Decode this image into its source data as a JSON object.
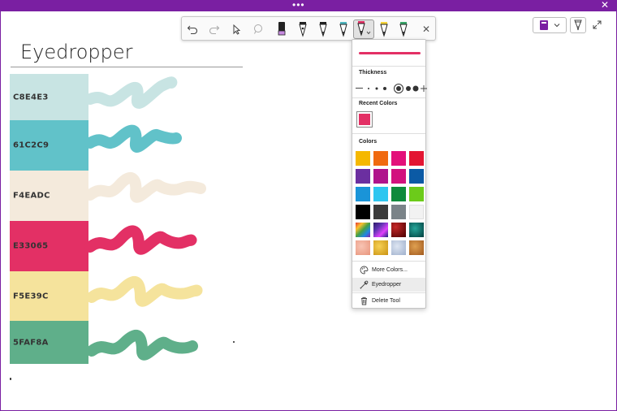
{
  "window": {
    "menu_dots": "•••",
    "close_glyph": "✕"
  },
  "page": {
    "title": "Eyedropper"
  },
  "swatches": [
    {
      "label": "C8E4E3",
      "color": "#C8E4E3"
    },
    {
      "label": "61C2C9",
      "color": "#61C2C9"
    },
    {
      "label": "F4EADC",
      "color": "#F4EADC"
    },
    {
      "label": "E33065",
      "color": "#E33065"
    },
    {
      "label": "F5E39C",
      "color": "#F5E39C"
    },
    {
      "label": "5FAF8A",
      "color": "#5FAF8A"
    }
  ],
  "toolbar": {
    "icons": [
      "undo-icon",
      "redo-icon",
      "select-cursor-icon",
      "lasso-icon",
      "highlighter-purple-icon",
      "pen-black-icon",
      "pen-black-icon",
      "pen-teal-icon",
      "pen-pink-icon",
      "pen-yellow-icon",
      "pen-green-icon",
      "close-icon"
    ],
    "close_glyph": "✕",
    "selected_pen_color": "#E33065"
  },
  "panel": {
    "current_color": "#E33065",
    "thickness_label": "Thickness",
    "recent_label": "Recent Colors",
    "recent_colors": [
      "#E33065"
    ],
    "colors_label": "Colors",
    "colors": [
      "#F5B800",
      "#F06A0F",
      "#E3107A",
      "#E31532",
      "#6B2FA0",
      "#B0148C",
      "#D2127E",
      "#0B5AA5",
      "#1A94D8",
      "#2EC6F0",
      "#0F8A3C",
      "#6CCB1A",
      "#000000",
      "#3A3A3A",
      "#7A8388",
      "#F2F2F2",
      "rainbow",
      "galaxy",
      "redtexture",
      "tealtexture",
      "peachtexture",
      "goldtexture",
      "silvertexture",
      "bronzetexture"
    ],
    "menu": [
      {
        "label": "More Colors...",
        "icon": "palette-icon"
      },
      {
        "label": "Eyedropper",
        "icon": "eyedropper-icon"
      },
      {
        "label": "Delete Tool",
        "icon": "trash-icon"
      }
    ]
  }
}
